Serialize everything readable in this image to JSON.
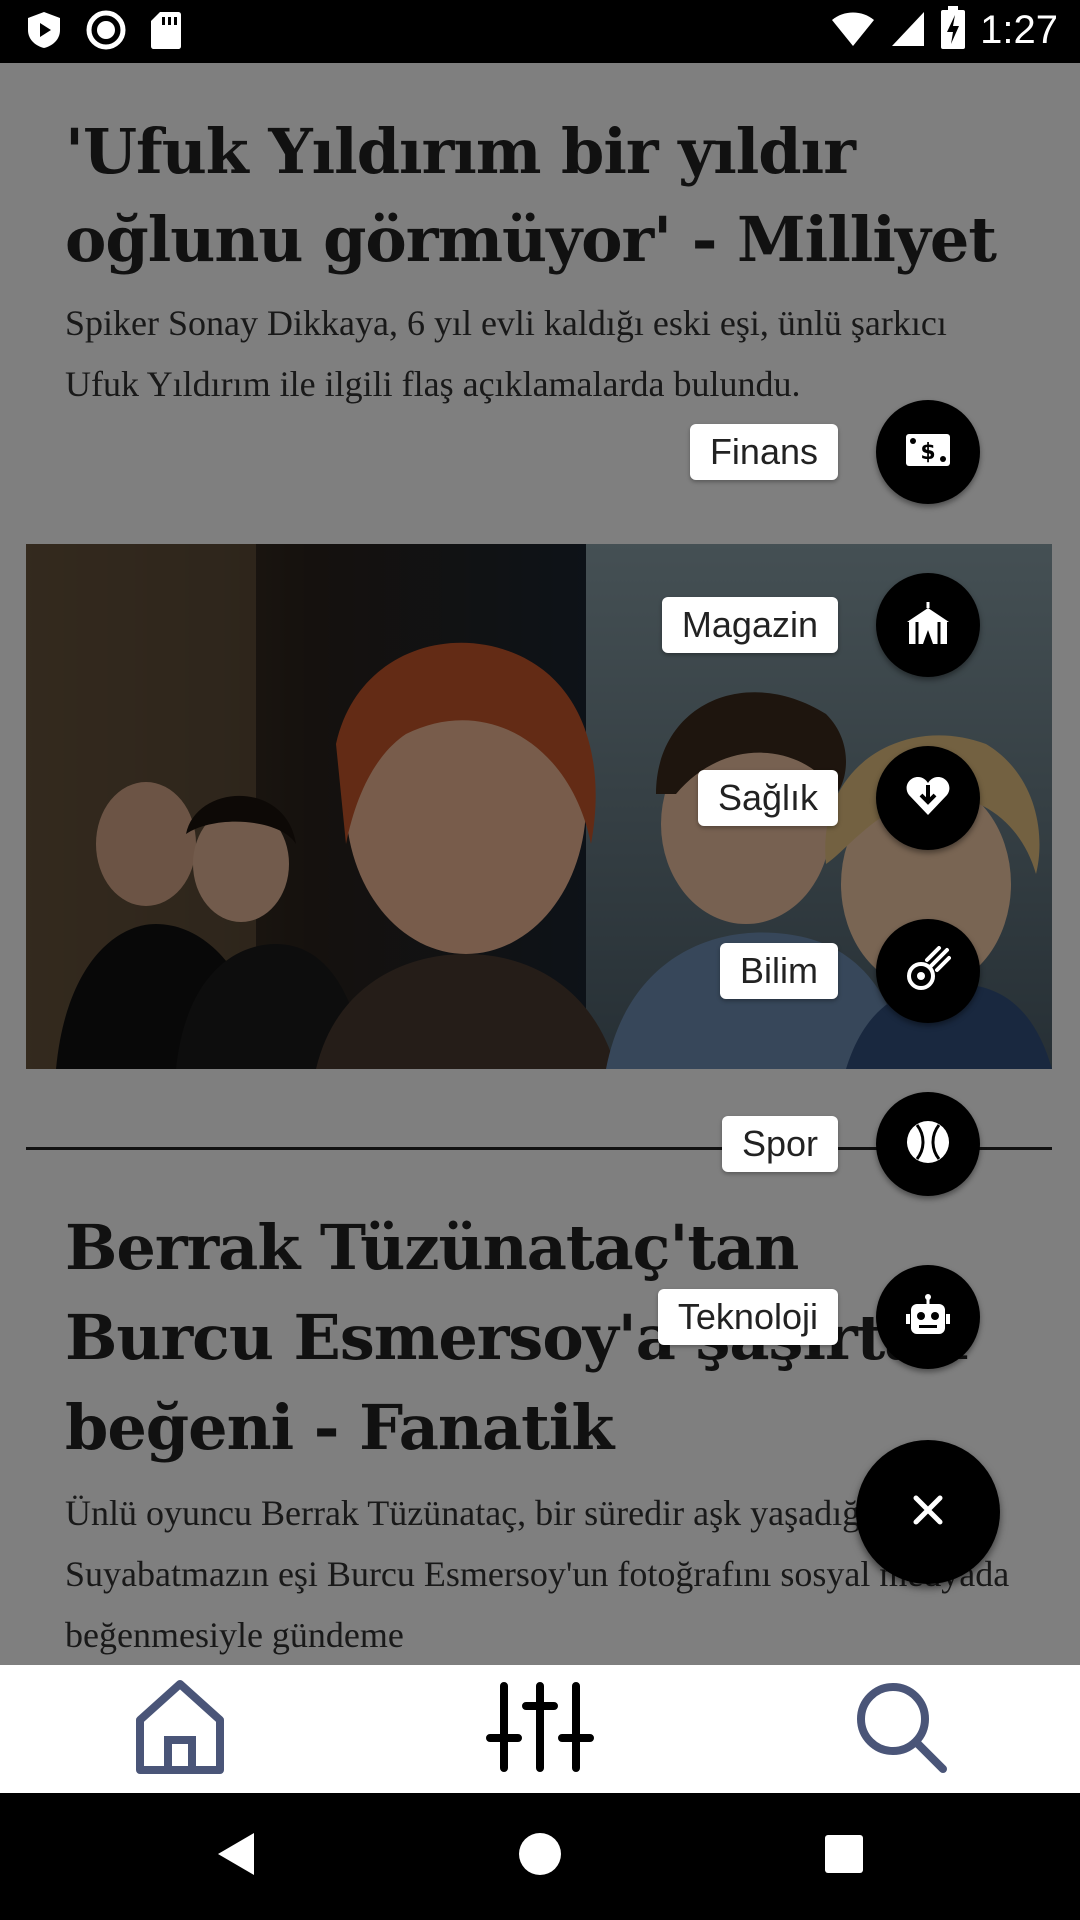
{
  "status_bar": {
    "time": "1:27",
    "icons": [
      "play-protect-icon",
      "record-icon",
      "sd-card-icon",
      "wifi-icon",
      "cell-signal-icon",
      "battery-charging-icon"
    ]
  },
  "articles": [
    {
      "title": "'Ufuk Yıldırım bir yıldır oğlunu görmüyor' - Milliyet",
      "summary": "Spiker Sonay Dikkaya, 6 yıl evli kaldığı eski eşi, ünlü şarkıcı Ufuk Yıldırım ile ilgili flaş açıklamalarda bulundu."
    },
    {
      "title": "Berrak Tüzünataç'tan Burcu Esmersoy'a şaşırtan beğeni - Fanatik",
      "summary": "Ünlü oyuncu Berrak Tüzünataç, bir süredir aşk yaşadığı Berk Suyabatmazın eşi Burcu Esmersoy'un fotoğrafını sosyal medyada beğenmesiyle gündeme"
    }
  ],
  "fab_menu": {
    "items": [
      {
        "label": "Finans",
        "icon": "money-icon"
      },
      {
        "label": "Magazin",
        "icon": "circus-tent-icon"
      },
      {
        "label": "Sağlık",
        "icon": "heart-icon"
      },
      {
        "label": "Bilim",
        "icon": "meteor-icon"
      },
      {
        "label": "Spor",
        "icon": "baseball-icon"
      },
      {
        "label": "Teknoloji",
        "icon": "robot-icon"
      }
    ],
    "close_icon": "close-icon"
  },
  "bottom_nav": {
    "items": [
      {
        "icon": "home-icon"
      },
      {
        "icon": "filter-sliders-icon"
      },
      {
        "icon": "search-icon"
      }
    ]
  },
  "system_nav": [
    "back-icon",
    "home-circle-icon",
    "recents-icon"
  ],
  "colors": {
    "nav_icon": "#4a5578",
    "fab": "#000000",
    "scrim": "rgba(0,0,0,0.5)"
  }
}
